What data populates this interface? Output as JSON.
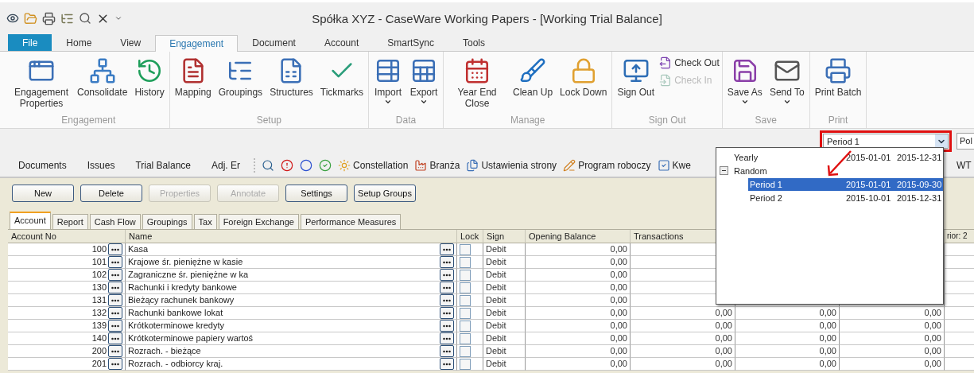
{
  "window": {
    "title": "Spółka XYZ - CaseWare Working Papers - [Working Trial Balance]"
  },
  "ribbon_tabs": [
    {
      "label": "File",
      "kind": "file",
      "selected": false
    },
    {
      "label": "Home",
      "kind": "tab",
      "selected": false
    },
    {
      "label": "View",
      "kind": "tab",
      "selected": false
    },
    {
      "label": "Engagement",
      "kind": "tab",
      "selected": true
    },
    {
      "label": "Document",
      "kind": "tab",
      "selected": false
    },
    {
      "label": "Account",
      "kind": "tab",
      "selected": false
    },
    {
      "label": "SmartSync",
      "kind": "tab",
      "selected": false
    },
    {
      "label": "Tools",
      "kind": "tab",
      "selected": false
    }
  ],
  "ribbon_groups": [
    {
      "label": "Engagement",
      "buttons": [
        {
          "label": "Engagement Properties",
          "kind": "large"
        },
        {
          "label": "Consolidate",
          "kind": "large"
        },
        {
          "label": "History",
          "kind": "large"
        }
      ]
    },
    {
      "label": "Setup",
      "buttons": [
        {
          "label": "Mapping",
          "kind": "large"
        },
        {
          "label": "Groupings",
          "kind": "large"
        },
        {
          "label": "Structures",
          "kind": "large"
        },
        {
          "label": "Tickmarks",
          "kind": "large"
        }
      ]
    },
    {
      "label": "Data",
      "buttons": [
        {
          "label": "Import",
          "kind": "large",
          "dropdown": true
        },
        {
          "label": "Export",
          "kind": "large",
          "dropdown": true
        }
      ]
    },
    {
      "label": "Manage",
      "buttons": [
        {
          "label": "Year End Close",
          "kind": "large"
        },
        {
          "label": "Clean Up",
          "kind": "large"
        },
        {
          "label": "Lock Down",
          "kind": "large"
        }
      ]
    },
    {
      "label": "Sign Out",
      "buttons": [
        {
          "label": "Sign Out",
          "kind": "large"
        },
        {
          "label": "Check Out",
          "kind": "small",
          "disabled": false
        },
        {
          "label": "Check In",
          "kind": "small",
          "disabled": true
        }
      ]
    },
    {
      "label": "Save",
      "buttons": [
        {
          "label": "Save As",
          "kind": "large",
          "dropdown": true
        },
        {
          "label": "Send To",
          "kind": "large",
          "dropdown": true
        }
      ]
    },
    {
      "label": "Print",
      "buttons": [
        {
          "label": "Print Batch",
          "kind": "large"
        }
      ]
    }
  ],
  "period_combo": {
    "value": "Period 1",
    "next_field": "Pol"
  },
  "toolbar": [
    {
      "kind": "text",
      "label": "Documents"
    },
    {
      "kind": "text",
      "label": "Issues"
    },
    {
      "kind": "text",
      "label": "Trial Balance"
    },
    {
      "kind": "text",
      "label": "Adj. Er"
    },
    {
      "kind": "separator"
    },
    {
      "kind": "icon"
    },
    {
      "kind": "icon"
    },
    {
      "kind": "icon"
    },
    {
      "kind": "icon"
    },
    {
      "kind": "labeled",
      "label": "Constellation"
    },
    {
      "kind": "labeled",
      "label": "Branża"
    },
    {
      "kind": "labeled",
      "label": "Ustawienia strony"
    },
    {
      "kind": "labeled",
      "label": "Program roboczy"
    },
    {
      "kind": "labeled",
      "label": "Kwe"
    }
  ],
  "toolbar_right_text": "WT",
  "action_buttons": [
    {
      "label": "New",
      "disabled": false
    },
    {
      "label": "Delete",
      "disabled": false
    },
    {
      "label": "Properties",
      "disabled": true
    },
    {
      "label": "Annotate",
      "disabled": true
    },
    {
      "label": "Settings",
      "disabled": false
    },
    {
      "label": "Setup Groups",
      "disabled": false
    }
  ],
  "sheet_tabs": [
    {
      "label": "Account",
      "selected": true
    },
    {
      "label": "Report",
      "selected": false
    },
    {
      "label": "Cash Flow",
      "selected": false
    },
    {
      "label": "Groupings",
      "selected": false
    },
    {
      "label": "Tax",
      "selected": false
    },
    {
      "label": "Foreign Exchange",
      "selected": false
    },
    {
      "label": "Performance Measures",
      "selected": false
    }
  ],
  "table": {
    "columns": [
      "Account No",
      "Name",
      "Lock",
      "Sign",
      "Opening Balance",
      "Transactions",
      "rior: 2"
    ],
    "rows": [
      {
        "account_no": "100",
        "name": "Kasa",
        "locked": false,
        "sign": "Debit",
        "opening_balance": "0,00"
      },
      {
        "account_no": "101",
        "name": "Krajowe śr. pieniężne w kasie",
        "locked": false,
        "sign": "Debit",
        "opening_balance": "0,00"
      },
      {
        "account_no": "102",
        "name": "Zagraniczne śr. pieniężne w ka",
        "locked": false,
        "sign": "Debit",
        "opening_balance": "0,00"
      },
      {
        "account_no": "130",
        "name": "Rachunki i kredyty bankowe",
        "locked": false,
        "sign": "Debit",
        "opening_balance": "0,00"
      },
      {
        "account_no": "131",
        "name": "Bieżący rachunek bankowy",
        "locked": false,
        "sign": "Debit",
        "opening_balance": "0,00"
      },
      {
        "account_no": "132",
        "name": "Rachunki bankowe lokat",
        "locked": false,
        "sign": "Debit",
        "opening_balance": "0,00",
        "transactions": "0,00",
        "column_7": "0,00",
        "column_8": "0,00"
      },
      {
        "account_no": "139",
        "name": "Krótkoterminowe kredyty",
        "locked": false,
        "sign": "Debit",
        "opening_balance": "0,00",
        "transactions": "0,00",
        "column_7": "0,00",
        "column_8": "0,00"
      },
      {
        "account_no": "140",
        "name": "Krótkoterminowe papiery wartoś",
        "locked": false,
        "sign": "Debit",
        "opening_balance": "0,00",
        "transactions": "0,00",
        "column_7": "0,00",
        "column_8": "0,00"
      },
      {
        "account_no": "200",
        "name": "Rozrach. - bieżące",
        "locked": false,
        "sign": "Debit",
        "opening_balance": "0,00",
        "transactions": "0,00",
        "column_7": "0,00",
        "column_8": "0,00"
      },
      {
        "account_no": "201",
        "name": "Rozrach. - odbiorcy kraj.",
        "locked": false,
        "sign": "Debit",
        "opening_balance": "0,00",
        "transactions": "0,00",
        "column_7": "0,00",
        "column_8": "0,00"
      }
    ]
  },
  "period_tree": [
    {
      "label": "Yearly",
      "start": "2015-01-01",
      "end": "2015-12-31",
      "selected": false
    },
    {
      "label": "Random",
      "expanded": true,
      "selected": false,
      "children": [
        {
          "label": "Period 1",
          "start": "2015-01-01",
          "end": "2015-09-30",
          "selected": true
        },
        {
          "label": "Period 2",
          "start": "2015-10-01",
          "end": "2015-12-31",
          "selected": false
        }
      ]
    }
  ]
}
